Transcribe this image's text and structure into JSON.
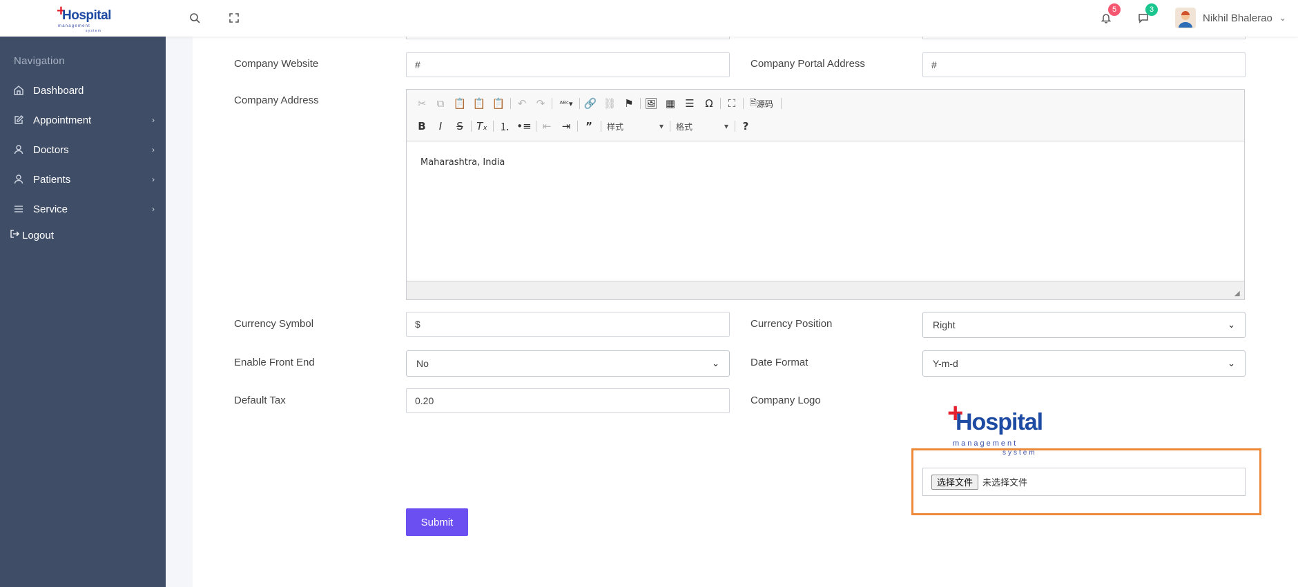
{
  "brand": {
    "word": "Hospital",
    "tagline": "management",
    "tagline2": "system"
  },
  "topbar": {
    "notifications_count": "5",
    "messages_count": "3",
    "user_name": "Nikhil Bhalerao",
    "colors": {
      "notif_badge": "#f4576f",
      "msg_badge": "#1bc58e"
    }
  },
  "sidebar": {
    "title": "Navigation",
    "items": [
      {
        "label": "Dashboard",
        "icon": "home-icon",
        "has_submenu": false
      },
      {
        "label": "Appointment",
        "icon": "edit-icon",
        "has_submenu": true
      },
      {
        "label": "Doctors",
        "icon": "user-icon",
        "has_submenu": true
      },
      {
        "label": "Patients",
        "icon": "user-icon",
        "has_submenu": true
      },
      {
        "label": "Service",
        "icon": "menu-icon",
        "has_submenu": true
      }
    ],
    "logout_label": "Logout"
  },
  "form": {
    "company_website": {
      "label": "Company Website",
      "value": "#"
    },
    "company_portal": {
      "label": "Company Portal Address",
      "value": "#"
    },
    "company_address": {
      "label": "Company Address",
      "editor_text": "Maharashtra, India",
      "source_label": "源码",
      "style_combo": "样式",
      "format_combo": "格式"
    },
    "currency_symbol": {
      "label": "Currency Symbol",
      "value": "$"
    },
    "currency_position": {
      "label": "Currency Position",
      "value": "Right"
    },
    "enable_front_end": {
      "label": "Enable Front End",
      "value": "No"
    },
    "date_format": {
      "label": "Date Format",
      "value": "Y-m-d"
    },
    "default_tax": {
      "label": "Default Tax",
      "value": "0.20"
    },
    "company_logo": {
      "label": "Company Logo",
      "file_button": "选择文件",
      "file_status": "未选择文件"
    },
    "submit_label": "Submit",
    "accent_color": "#6b4ff0",
    "highlight_color": "#ec8a3a"
  }
}
